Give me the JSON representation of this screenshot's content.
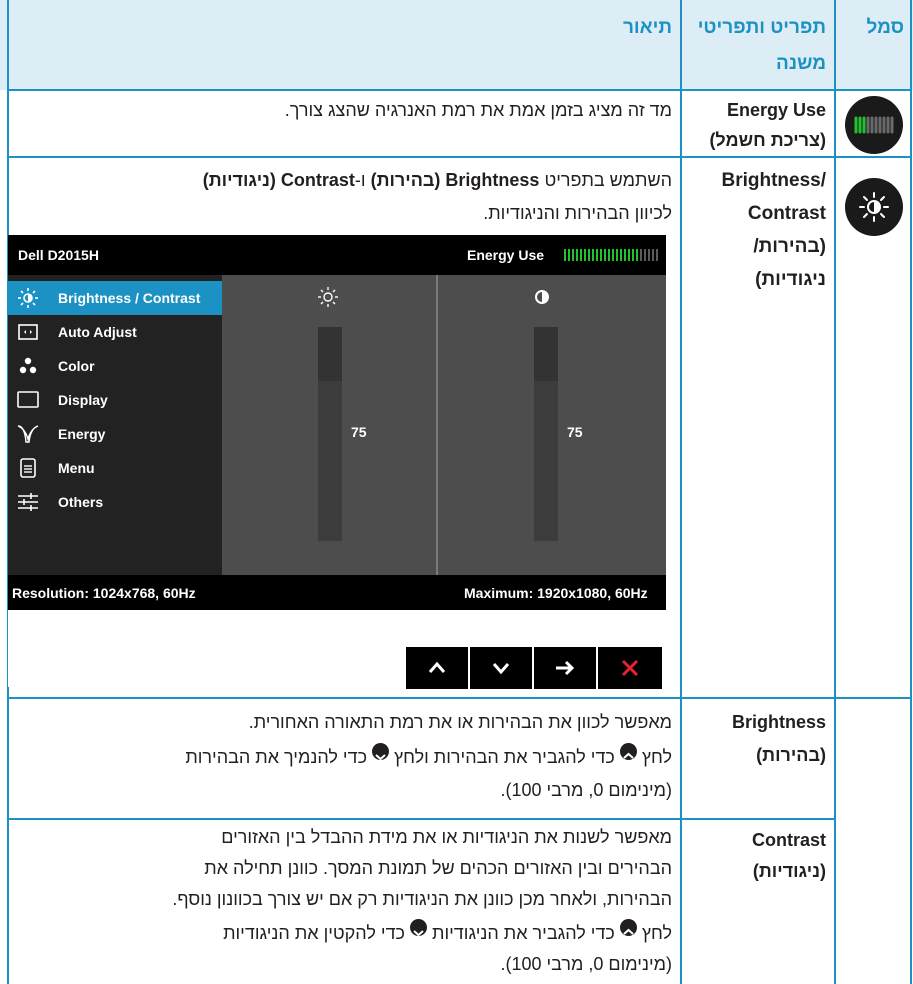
{
  "header": {
    "col_symbol": "סמל",
    "col_feature": "תפריט ותפריטי משנה",
    "col_description": "תיאור"
  },
  "rows": {
    "energy": {
      "feature_en": "Energy Use",
      "feature_he": "(צריכת חשמל)",
      "description": "מד זה מציג בזמן אמת את רמת האנרגיה שהצג צורך."
    },
    "brightness_contrast": {
      "feature_line1": "/Brightness",
      "feature_line2": "Contrast",
      "feature_line3": "(בהירות/",
      "feature_line4": "ניגודיות)",
      "desc_pre": "השתמש בתפריט ",
      "desc_b1": "Brightness (בהירות)",
      "desc_mid": " ו-",
      "desc_b2": "Contrast (ניגודיות)",
      "desc_line2": "לכיוון הבהירות והניגודיות."
    },
    "brightness": {
      "feature_en": "Brightness",
      "feature_he": "(בהירות)",
      "line1": "מאפשר לכוון את הבהירות או את רמת התאורה האחורית.",
      "line2a": "לחץ ",
      "line2b": " כדי להגביר את הבהירות ולחץ ",
      "line2c": " כדי להנמיך את הבהירות",
      "line3": "(מינימום 0, מרבי 100)."
    },
    "contrast": {
      "feature_en": "Contrast",
      "feature_he": "(ניגודיות)",
      "line1": "מאפשר לשנות את הניגודיות או את מידת ההבדל בין האזורים",
      "line2": "הבהירים ובין האזורים הכהים של תמונת המסך. כוונן תחילה את",
      "line3": "הבהירות, ולאחר מכן כוונן את הניגודיות רק אם יש צורך בכוונון נוסף.",
      "line4a": "לחץ ",
      "line4b": " כדי להגביר את הניגודיות ",
      "line4c": " כדי להקטין את הניגודיות",
      "line5": "(מינימום 0, מרבי 100)."
    }
  },
  "osd": {
    "model": "Dell D2015H",
    "energy_label": "Energy Use",
    "energy_level": 0.8,
    "menu": [
      {
        "label": "Brightness / Contrast",
        "icon": "sun-icon",
        "selected": true
      },
      {
        "label": "Auto Adjust",
        "icon": "auto-adjust-icon",
        "selected": false
      },
      {
        "label": "Color",
        "icon": "color-dots-icon",
        "selected": false
      },
      {
        "label": "Display",
        "icon": "display-icon",
        "selected": false
      },
      {
        "label": "Energy",
        "icon": "energy-leaf-icon",
        "selected": false
      },
      {
        "label": "Menu",
        "icon": "menu-icon",
        "selected": false
      },
      {
        "label": "Others",
        "icon": "sliders-icon",
        "selected": false
      }
    ],
    "brightness_value": "75",
    "contrast_value": "75",
    "resolution": "Resolution: 1024x768, 60Hz",
    "maximum": "Maximum: 1920x1080, 60Hz",
    "accent_color": "#1b91c4",
    "close_color": "#e8212b"
  }
}
